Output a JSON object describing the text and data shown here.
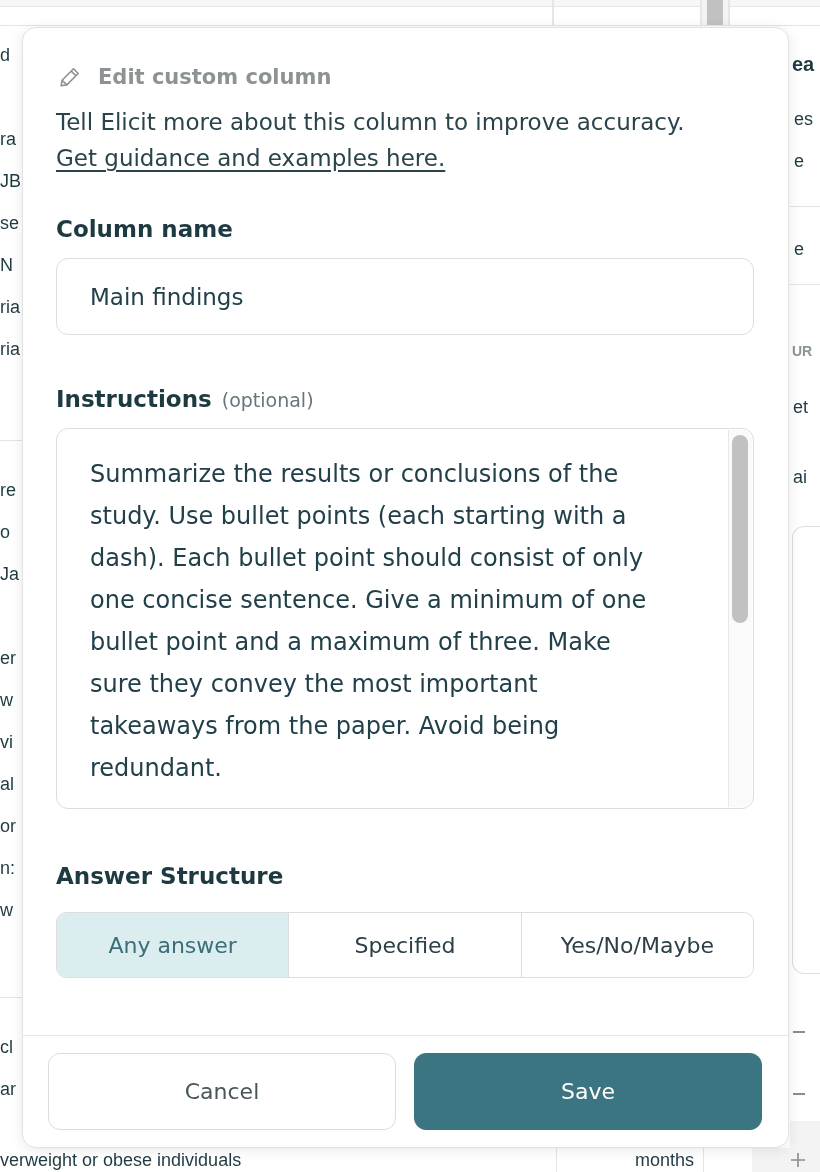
{
  "background_table": {
    "left_column": [
      {
        "paragraphs": [
          [
            "d"
          ],
          [
            "ra",
            "JB",
            "se",
            "N",
            "ria",
            "ria"
          ]
        ]
      },
      {
        "paragraphs": [
          [
            "re",
            "o",
            "Ja"
          ],
          [
            "er",
            "w",
            "vi",
            "al",
            "or",
            "n:",
            "w"
          ]
        ]
      },
      {
        "paragraphs": [
          [
            "cl",
            "ar"
          ]
        ]
      }
    ],
    "bottom_row": {
      "column_1": "verweight or obese individuals",
      "column_2": "months"
    }
  },
  "side_panel": {
    "heading": "ea",
    "lines": [
      "es",
      "e"
    ],
    "row_text": "e",
    "section_label": "UR",
    "items": [
      "et",
      "ai"
    ]
  },
  "dialog": {
    "title": "Edit custom column",
    "description": "Tell Elicit more about this column to improve accuracy.",
    "link": "Get guidance and examples here.",
    "column_name": {
      "label": "Column name",
      "value": "Main findings"
    },
    "instructions": {
      "label": "Instructions",
      "hint": "(optional)",
      "value": "Summarize the results or conclusions of the study. Use bullet points (each starting with a dash). Each bullet point should consist of only one concise sentence. Give a minimum of one bullet point and a maximum of three. Make sure they convey the most important takeaways from the paper. Avoid being redundant."
    },
    "answer_structure": {
      "label": "Answer Structure",
      "options": [
        {
          "label": "Any answer",
          "selected": true
        },
        {
          "label": "Specified",
          "selected": false
        },
        {
          "label": "Yes/No/Maybe",
          "selected": false
        }
      ]
    },
    "buttons": [
      {
        "label": "Cancel",
        "kind": "secondary"
      },
      {
        "label": "Save",
        "kind": "primary"
      }
    ]
  }
}
